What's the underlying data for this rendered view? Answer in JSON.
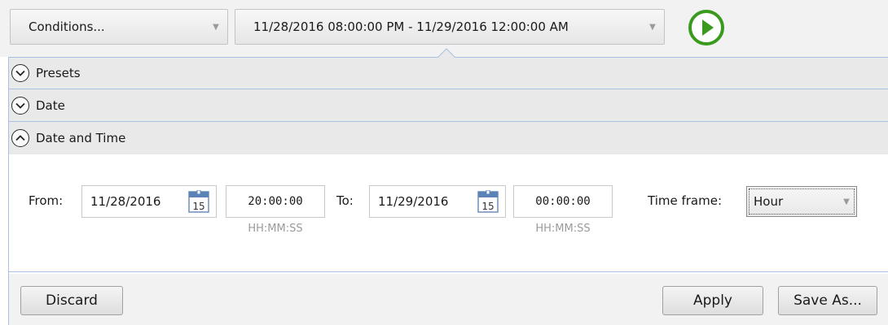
{
  "toolbar": {
    "conditions_label": "Conditions...",
    "range_label": "11/28/2016 08:00:00 PM - 11/29/2016 12:00:00 AM",
    "run_icon": "play-circle-icon",
    "accent_color": "#3a9a1e"
  },
  "sections": [
    {
      "label": "Presets",
      "state": "collapsed"
    },
    {
      "label": "Date",
      "state": "collapsed"
    },
    {
      "label": "Date and Time",
      "state": "expanded"
    }
  ],
  "date_time": {
    "from_label": "From:",
    "from_date": "11/28/2016",
    "from_time": "20:00:00",
    "to_label": "To:",
    "to_date": "11/29/2016",
    "to_time": "00:00:00",
    "time_hint": "HH:MM:SS",
    "calendar_day": "15",
    "timeframe_label": "Time frame:",
    "timeframe_value": "Hour"
  },
  "footer": {
    "discard_label": "Discard",
    "apply_label": "Apply",
    "saveas_label": "Save As..."
  }
}
